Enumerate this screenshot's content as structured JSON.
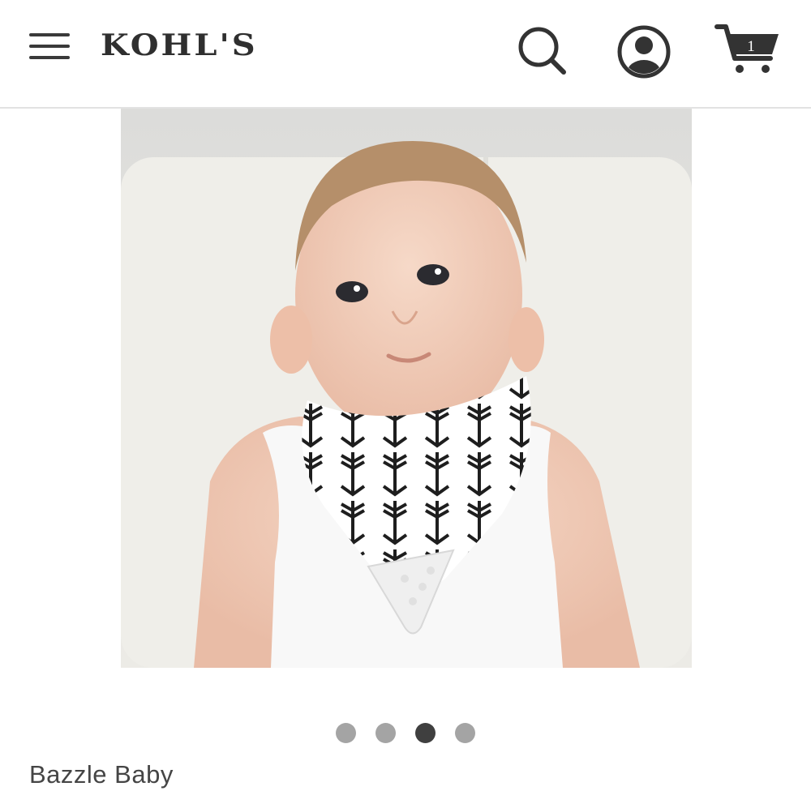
{
  "header": {
    "menu_icon": "hamburger-menu-icon",
    "logo_text": "KOHL'S",
    "search_icon": "search-icon",
    "account_icon": "account-icon",
    "cart_icon": "shopping-cart-icon",
    "cart_count": "1"
  },
  "product": {
    "image_icon": "product-photo",
    "carousel": {
      "total": 4,
      "active_index": 3
    },
    "brand": "Bazzle Baby"
  },
  "colors": {
    "header_text": "#2f2f2f",
    "dot_inactive": "#a4a4a4",
    "dot_active": "#3f3f3f",
    "divider": "#e2e2e2"
  }
}
